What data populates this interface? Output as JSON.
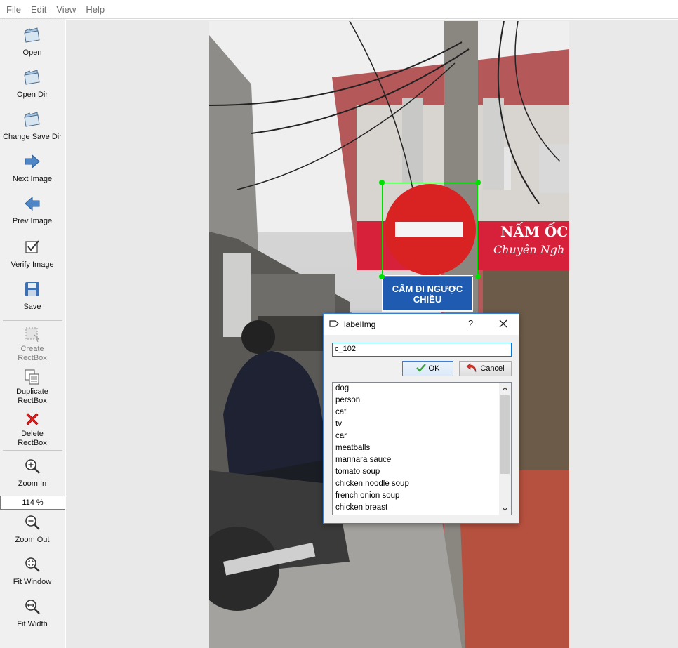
{
  "menu": [
    "File",
    "Edit",
    "View",
    "Help"
  ],
  "toolbar": {
    "open": "Open",
    "open_dir": "Open Dir",
    "change_save_dir": "Change Save Dir",
    "next_image": "Next Image",
    "prev_image": "Prev Image",
    "verify_image": "Verify Image",
    "save": "Save",
    "create_rectbox": [
      "Create",
      "RectBox"
    ],
    "duplicate_rectbox": [
      "Duplicate",
      "RectBox"
    ],
    "delete_rectbox": [
      "Delete",
      "RectBox"
    ],
    "zoom_in": "Zoom In",
    "zoom_level": "114 %",
    "zoom_out": "Zoom Out",
    "fit_window": "Fit Window",
    "fit_width": "Fit Width"
  },
  "image_text": {
    "blue_sign": "CẤM ĐI NGƯỢC CHIỀU",
    "shop_sign": "NẤM ỐC",
    "shop_sub": "Chuyên Ngh"
  },
  "dialog": {
    "title": "labelImg",
    "help": "?",
    "label_value": "c_102",
    "ok_label": "OK",
    "cancel_label": "Cancel",
    "labels": [
      "dog",
      "person",
      "cat",
      "tv",
      "car",
      "meatballs",
      "marinara sauce",
      "tomato soup",
      "chicken noodle soup",
      "french onion soup",
      "chicken breast"
    ]
  },
  "colors": {
    "bbox": "#00e000",
    "sign_red": "#d92323",
    "sign_blue": "#1f5bb0",
    "accent": "#0078d7"
  }
}
